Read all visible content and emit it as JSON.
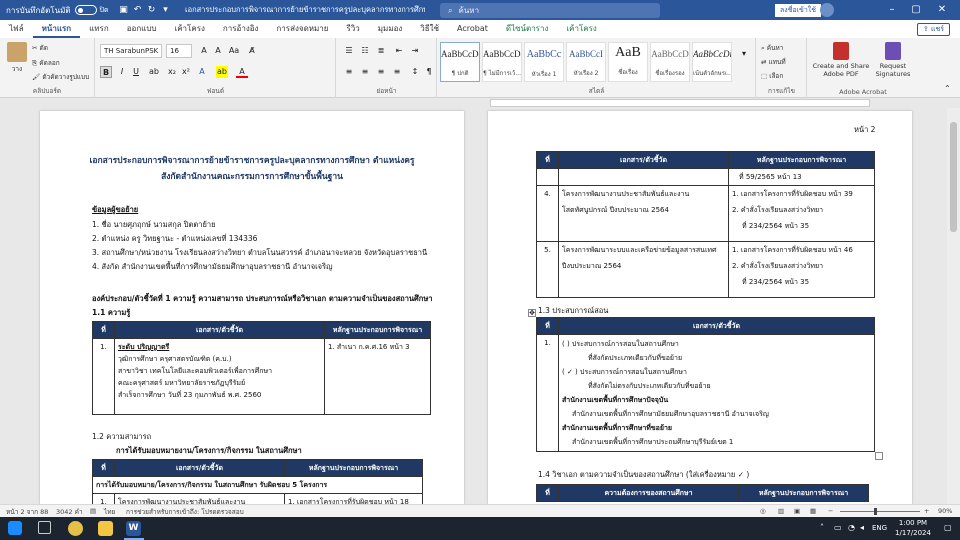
{
  "titlebar": {
    "autosave_label": "การบันทึกอัตโนมัติ",
    "autosave_state": "ปิด",
    "doc_title": "เอกสารประกอบการพิจารณาการย้ายข้าราชการครูปละบุคลากรทางการศึกษา ตำแหน่งครู",
    "search_placeholder": "ค้นหา",
    "signin_label": "ลงชื่อเข้าใช้",
    "accent_color": "#2b579a"
  },
  "tabs": [
    "ไฟล์",
    "หน้าแรก",
    "แทรก",
    "ออกแบบ",
    "เค้าโครง",
    "การอ้างอิง",
    "การส่งจดหมาย",
    "รีวิว",
    "มุมมอง",
    "วิธีใช้",
    "Acrobat",
    "ดีไซน์ตาราง",
    "เค้าโครง"
  ],
  "active_tab": "หน้าแรก",
  "share_label": "แชร์",
  "ribbon": {
    "clipboard": {
      "paste": "วาง",
      "cut": "ตัด",
      "copy": "คัดลอก",
      "format_painter": "ตัวคัดวางรูปแบบ",
      "label": "คลิปบอร์ด"
    },
    "font": {
      "font_name": "TH SarabunPSK",
      "font_size": "16",
      "label": "ฟอนต์",
      "bold": "B",
      "italic": "I",
      "underline": "U"
    },
    "paragraph": {
      "label": "ย่อหน้า"
    },
    "styles": {
      "label": "สไตล์",
      "items": [
        {
          "preview": "AaBbCcDc",
          "name": "¶ ปกติ"
        },
        {
          "preview": "AaBbCcDc",
          "name": "¶ ไม่มีการเว้..."
        },
        {
          "preview": "AaBbCc",
          "name": "หัวเรื่อง 1"
        },
        {
          "preview": "AaBbCcI",
          "name": "หัวเรื่อง 2"
        },
        {
          "preview": "AaB",
          "name": "ชื่อเรื่อง"
        },
        {
          "preview": "AaBbCcD",
          "name": "ชื่อเรื่องรอง"
        },
        {
          "preview": "AaBbCcDi",
          "name": "เน้นตัวอักษรเ..."
        }
      ]
    },
    "editing": {
      "find": "ค้นหา",
      "replace": "แทนที่",
      "select": "เลือก",
      "label": "การแก้ไข"
    },
    "acrobat": {
      "create_share": "Create and Share Adobe PDF",
      "request_sig": "Request Signatures",
      "label": "Adobe Acrobat"
    }
  },
  "page1": {
    "title_line1": "เอกสารประกอบการพิจารณาการย้ายข้าราชการครูปละบุคลากรทางการศึกษา ตำแหน่งครู",
    "title_line2": "สังกัดสำนักงานคณะกรรมการการศึกษาขั้นพื้นฐาน",
    "section_info": "ข้อมูลผู้ขอย้าย",
    "info1": "1.  ชื่อ  นายศุภฤกษ์     นามสกุล   ปิตตาย้าย",
    "info2": "2.  ตำแหน่ง  ครู     วิทยฐานะ  -      ตำแหน่งเลขที่  134336",
    "info3": "3.  สถานศึกษา/หน่วยงาน  โรงเรียนลงสว่างวิทยา ตำบลโนนสวรรค์ อำเภอนาจะหลวย จังหวัดอุบลราชธานี",
    "info4": "4.  สังกัด  สำนักงานเขตพื้นที่การศึกษามัธยมศึกษาอุบลราชธานี อำนาจเจริญ",
    "component1": "องค์ประกอบ/ตัวชี้วัดที่ 1 ความรู้ ความสามารถ ประสบการณ์หรือวิชาเอก  ตามความจำเป็นของสถานศึกษา",
    "sub11": "1.1 ความรู้",
    "table_headers": [
      "ที่",
      "เอกสาร/ตัวชี้วัด",
      "หลักฐานประกอบการพิจารณา"
    ],
    "t11_no": "1.",
    "t11_lines": [
      "ระดับ ปริญญาตรี",
      "วุฒิการศึกษา ครุศาสตรบัณฑิต (ค.บ.)",
      "สาขาวิชา เทคโนโลยีและคอมพิวเตอร์เพื่อการศึกษา",
      "คณะครุศาสตร์   มหาวิทยาลัยราชภัฏบุรีรัมย์",
      "สำเร็จการศึกษา วันที่ 23 กุมภาพันธ์ พ.ศ. 2560"
    ],
    "t11_evidence": "1. สำเนา ก.ค.ศ.16  หน้า 3",
    "sub12": "1.2 ความสามารถ",
    "sub12_desc": "การได้รับมอบหมายงาน/โครงการ/กิจกรรม ในสถานศึกษา",
    "t12_span": "การได้รับมอบหมาย/โครงการ/กิจกรรม ในสถานศึกษา รับผิดชอบ  5 โครงการ",
    "t12_row1_no": "1.",
    "t12_row1_text": "โครงการพัฒนางานประชาสัมพันธ์และงาน",
    "t12_row1_evidence": "1. เอกสารโครงการที่รับผิดชอบ  หน้า 18"
  },
  "page2": {
    "page_number": "หน้า 2",
    "table_headers": [
      "ที่",
      "เอกสาร/ตัวชี้วัด",
      "หลักฐานประกอบการพิจารณา"
    ],
    "cont_evidence": "ที่ 59/2565 หน้า 13",
    "r4_no": "4.",
    "r4_text": [
      "โครงการพัฒนางานประชาสัมพันธ์และงาน",
      "โสตทัศนูปกรณ์ ปีงบประมาณ 2564"
    ],
    "r4_evidence": [
      "1. เอกสารโครงการที่รับผิดชอบ  หน้า 39",
      "2. คำสั่งโรงเรียนลงสว่างวิทยา",
      "    ที่ 234/2564 หน้า 35"
    ],
    "r5_no": "5.",
    "r5_text": [
      "โครงการพัฒนาระบบและเครือข่ายข้อมูลสารสนเทศ",
      "ปีงบประมาณ 2564"
    ],
    "r5_evidence": [
      "1. เอกสารโครงการที่รับผิดชอบ  หน้า 46",
      "2. คำสั่งโรงเรียนลงสว่างวิทยา",
      "    ที่ 234/2564 หน้า 35"
    ],
    "sub13": "1.3 ประสบการณ์สอน",
    "t13_no": "1.",
    "t13_lines": [
      "(     )  ประสบการณ์การสอนในสถานศึกษา",
      "ที่สังกัดประเภทเดียวกับที่ขอย้าย",
      "(  ✓  )  ประสบการณ์การสอนในสถานศึกษา",
      "ที่สังกัดไม่ตรงกับประเภทเดียวกับที่ขอย้าย",
      "สำนักงานเขตพื้นที่การศึกษาปัจจุบัน",
      "สำนักงานเขตพื้นที่การศึกษามัธยมศึกษาอุบลราชธานี อำนาจเจริญ",
      "สำนักงานเขตพื้นที่การศึกษาที่ขอย้าย",
      "สำนักงานเขตพื้นที่การศึกษาประถมศึกษาบุรีรัมย์เขต 1"
    ],
    "sub14": "1.4 วิชาเอก ตามความจำเป็นของสถานศึกษา (ใส่เครื่องหมาย ✓ )",
    "t14_headers": [
      "ที่",
      "ความต้องการของสถานศึกษา",
      "หลักฐานประกอบการพิจารณา"
    ]
  },
  "statusbar": {
    "page": "หน้า 2 จาก 88",
    "words": "3042 คำ",
    "language": "ไทย",
    "accessibility": "การช่วยสำหรับการเข้าถึง: โปรดตรวจสอบ",
    "zoom": "90%"
  },
  "taskbar": {
    "time": "1:00 PM",
    "date": "1/17/2024",
    "lang": "ENG"
  }
}
